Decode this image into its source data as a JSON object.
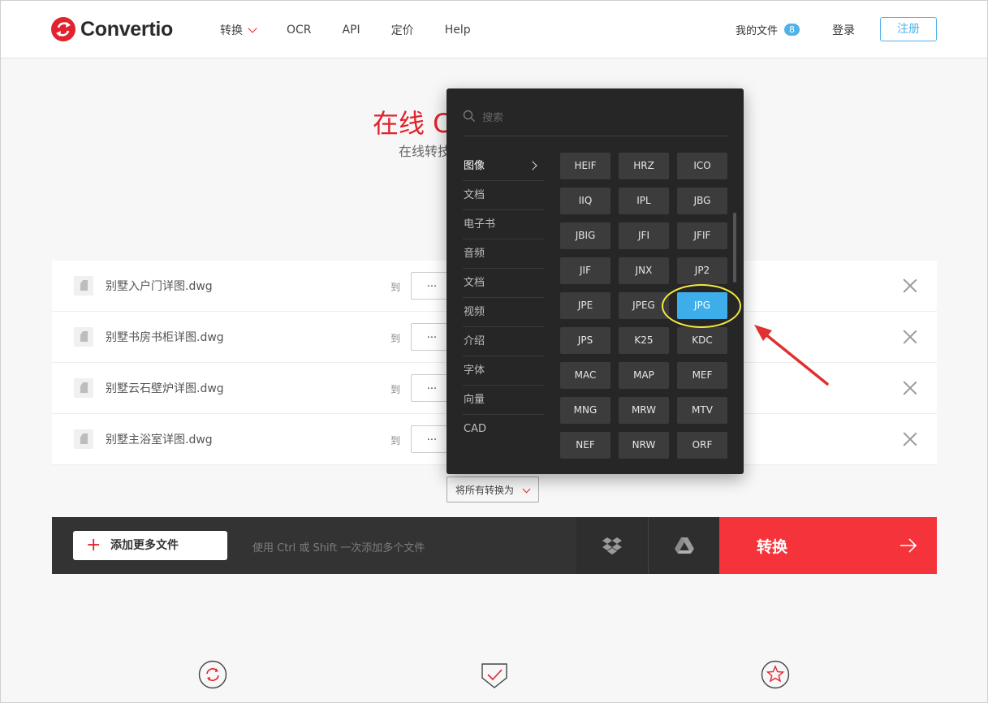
{
  "header": {
    "logo_text": "Convertio",
    "nav": [
      "转换",
      "OCR",
      "API",
      "定价",
      "Help"
    ],
    "my_files_label": "我的文件",
    "my_files_count": "8",
    "login_label": "登录",
    "register_label": "注册"
  },
  "hero": {
    "title_visible": "在线 C",
    "subtitle_visible": "在线转技"
  },
  "files": [
    {
      "name": "别墅入户门详图.dwg",
      "to": "到",
      "format": "..."
    },
    {
      "name": "别墅书房书柜详图.dwg",
      "to": "到",
      "format": "..."
    },
    {
      "name": "别墅云石壁炉详图.dwg",
      "to": "到",
      "format": "..."
    },
    {
      "name": "别墅主浴室详图.dwg",
      "to": "到",
      "format": "..."
    }
  ],
  "convert_all_label": "将所有转换为",
  "actionbar": {
    "add_files_label": "添加更多文件",
    "hint": "使用 Ctrl 或 Shift 一次添加多个文件",
    "convert_label": "转换"
  },
  "dropdown": {
    "search_placeholder": "搜索",
    "categories": [
      "图像",
      "文档",
      "电子书",
      "音频",
      "文档",
      "视频",
      "介绍",
      "字体",
      "向量",
      "CAD"
    ],
    "active_category": "图像",
    "formats": [
      "HEIF",
      "HRZ",
      "ICO",
      "IIQ",
      "IPL",
      "JBG",
      "JBIG",
      "JFI",
      "JFIF",
      "JIF",
      "JNX",
      "JP2",
      "JPE",
      "JPEG",
      "JPG",
      "JPS",
      "K25",
      "KDC",
      "MAC",
      "MAP",
      "MEF",
      "MNG",
      "MRW",
      "MTV",
      "NEF",
      "NRW",
      "ORF"
    ],
    "selected_format": "JPG"
  },
  "colors": {
    "brand_red": "#e0232e",
    "convert_red": "#f4343a",
    "accent_blue": "#3daee9",
    "dropdown_bg": "#262626",
    "highlight_yellow": "#f3ea3c",
    "arrow_red": "#e03030"
  },
  "icons": [
    "search-icon",
    "file-icon",
    "close-icon",
    "dropbox-icon",
    "google-drive-icon",
    "arrow-right-icon",
    "refresh-icon",
    "shield-check-icon",
    "star-icon"
  ]
}
